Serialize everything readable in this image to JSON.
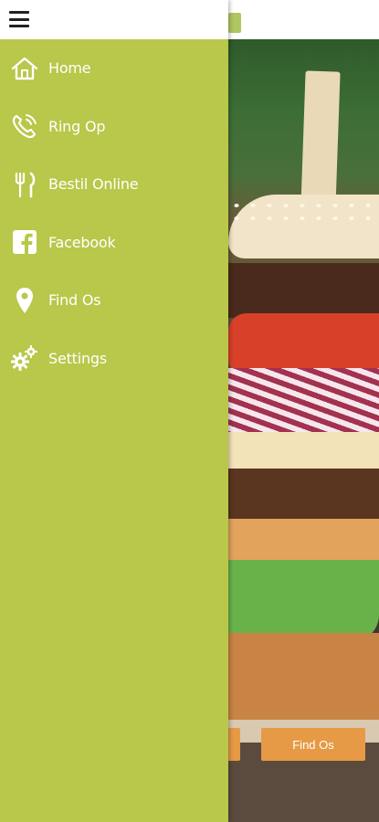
{
  "menu": {
    "items": [
      {
        "label": "Home",
        "icon": "home-icon"
      },
      {
        "label": "Ring Op",
        "icon": "phone-icon"
      },
      {
        "label": "Bestil Online",
        "icon": "fork-knife-icon"
      },
      {
        "label": "Facebook",
        "icon": "facebook-icon"
      },
      {
        "label": "Find Os",
        "icon": "location-pin-icon"
      },
      {
        "label": "Settings",
        "icon": "gears-icon"
      }
    ]
  },
  "background": {
    "find_button_label": "Find Os"
  },
  "colors": {
    "drawer": "#b9c74a",
    "header": "#ffffff",
    "button": "#e69a45"
  }
}
